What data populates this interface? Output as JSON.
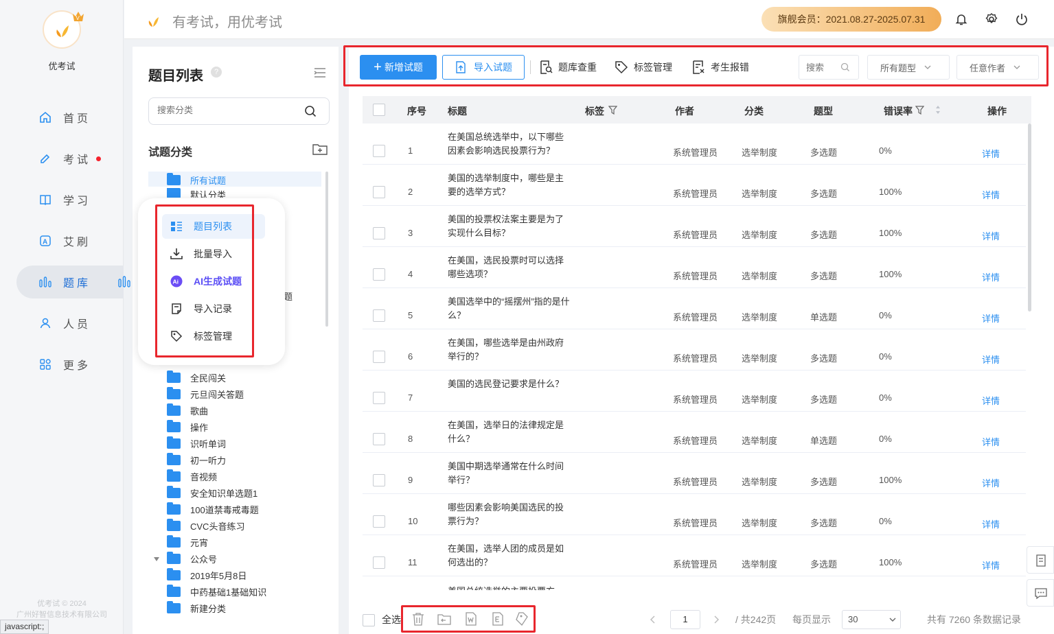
{
  "app": {
    "name": "优考试",
    "slogan": "有考试，用优考试",
    "copyright": "优考试 © 2024",
    "company": "广州好智信息技术有限公司",
    "status_url": "javascript:;"
  },
  "member": {
    "label": "旗舰会员：2021.08.27-2025.07.31"
  },
  "nav": [
    {
      "label": "首页",
      "icon": "home-icon"
    },
    {
      "label": "考试",
      "icon": "exam-icon"
    },
    {
      "label": "学习",
      "icon": "book-icon"
    },
    {
      "label": "艾刷",
      "icon": "ai-brush-icon"
    },
    {
      "label": "题库",
      "icon": "bar-chart-icon"
    },
    {
      "label": "人员",
      "icon": "user-icon"
    },
    {
      "label": "更多",
      "icon": "apps-icon"
    }
  ],
  "category_panel": {
    "title": "题目列表",
    "search_placeholder": "搜索分类",
    "subtitle": "试题分类",
    "items_top": [
      "所有试题",
      "默认分类"
    ],
    "partial_text": "题",
    "items": [
      "全民闯关",
      "元旦闯关答题",
      "歌曲",
      "操作",
      "识听单词",
      "初一听力",
      "音视频",
      "安全知识单选题1",
      "100道禁毒戒毒题",
      "CVC头音练习",
      "元宵",
      "公众号",
      "2019年5月8日",
      "中药基础1基础知识",
      "新建分类"
    ]
  },
  "popup_menu": [
    "题目列表",
    "批量导入",
    "AI生成试题",
    "导入记录",
    "标签管理"
  ],
  "toolbar": {
    "add": "新增试题",
    "import": "导入试题",
    "dedupe": "题库查重",
    "tags": "标签管理",
    "errors": "考生报错",
    "search_placeholder": "搜索",
    "type_filter": "所有题型",
    "author_filter": "任意作者"
  },
  "table": {
    "headers": [
      "序号",
      "标题",
      "标签",
      "作者",
      "分类",
      "题型",
      "错误率",
      "操作"
    ],
    "rows": [
      {
        "no": "1",
        "title": "在美国总统选举中，以下哪些因素会影响选民投票行为？",
        "author": "系统管理员",
        "category": "选举制度",
        "type": "多选题",
        "rate": "0%",
        "action": "详情"
      },
      {
        "no": "2",
        "title": "美国的选举制度中，哪些是主要的选举方式？",
        "author": "系统管理员",
        "category": "选举制度",
        "type": "多选题",
        "rate": "100%",
        "action": "详情"
      },
      {
        "no": "3",
        "title": "美国的投票权法案主要是为了实现什么目标？",
        "author": "系统管理员",
        "category": "选举制度",
        "type": "多选题",
        "rate": "100%",
        "action": "详情"
      },
      {
        "no": "4",
        "title": "在美国，选民投票时可以选择哪些选项？",
        "author": "系统管理员",
        "category": "选举制度",
        "type": "多选题",
        "rate": "100%",
        "action": "详情"
      },
      {
        "no": "5",
        "title": "美国选举中的“摇摆州”指的是什么？",
        "author": "系统管理员",
        "category": "选举制度",
        "type": "单选题",
        "rate": "0%",
        "action": "详情"
      },
      {
        "no": "6",
        "title": "在美国，哪些选举是由州政府举行的？",
        "author": "系统管理员",
        "category": "选举制度",
        "type": "多选题",
        "rate": "0%",
        "action": "详情"
      },
      {
        "no": "7",
        "title": "美国的选民登记要求是什么？",
        "author": "系统管理员",
        "category": "选举制度",
        "type": "多选题",
        "rate": "0%",
        "action": "详情"
      },
      {
        "no": "8",
        "title": "在美国，选举日的法律规定是什么？",
        "author": "系统管理员",
        "category": "选举制度",
        "type": "单选题",
        "rate": "0%",
        "action": "详情"
      },
      {
        "no": "9",
        "title": "美国中期选举通常在什么时间举行？",
        "author": "系统管理员",
        "category": "选举制度",
        "type": "多选题",
        "rate": "100%",
        "action": "详情"
      },
      {
        "no": "10",
        "title": "哪些因素会影响美国选民的投票行为？",
        "author": "系统管理员",
        "category": "选举制度",
        "type": "多选题",
        "rate": "0%",
        "action": "详情"
      },
      {
        "no": "11",
        "title": "在美国，选举人团的成员是如何选出的？",
        "author": "系统管理员",
        "category": "选举制度",
        "type": "多选题",
        "rate": "100%",
        "action": "详情"
      },
      {
        "no": "",
        "title": "美国总统选举的主要投票方",
        "author": "",
        "category": "",
        "type": "",
        "rate": "",
        "action": ""
      }
    ]
  },
  "footer": {
    "select_all": "全选",
    "page": "1",
    "total_pages": "/ 共242页",
    "per_page_label": "每页显示",
    "per_page": "30",
    "total_records": "共有 7260 条数据记录"
  }
}
